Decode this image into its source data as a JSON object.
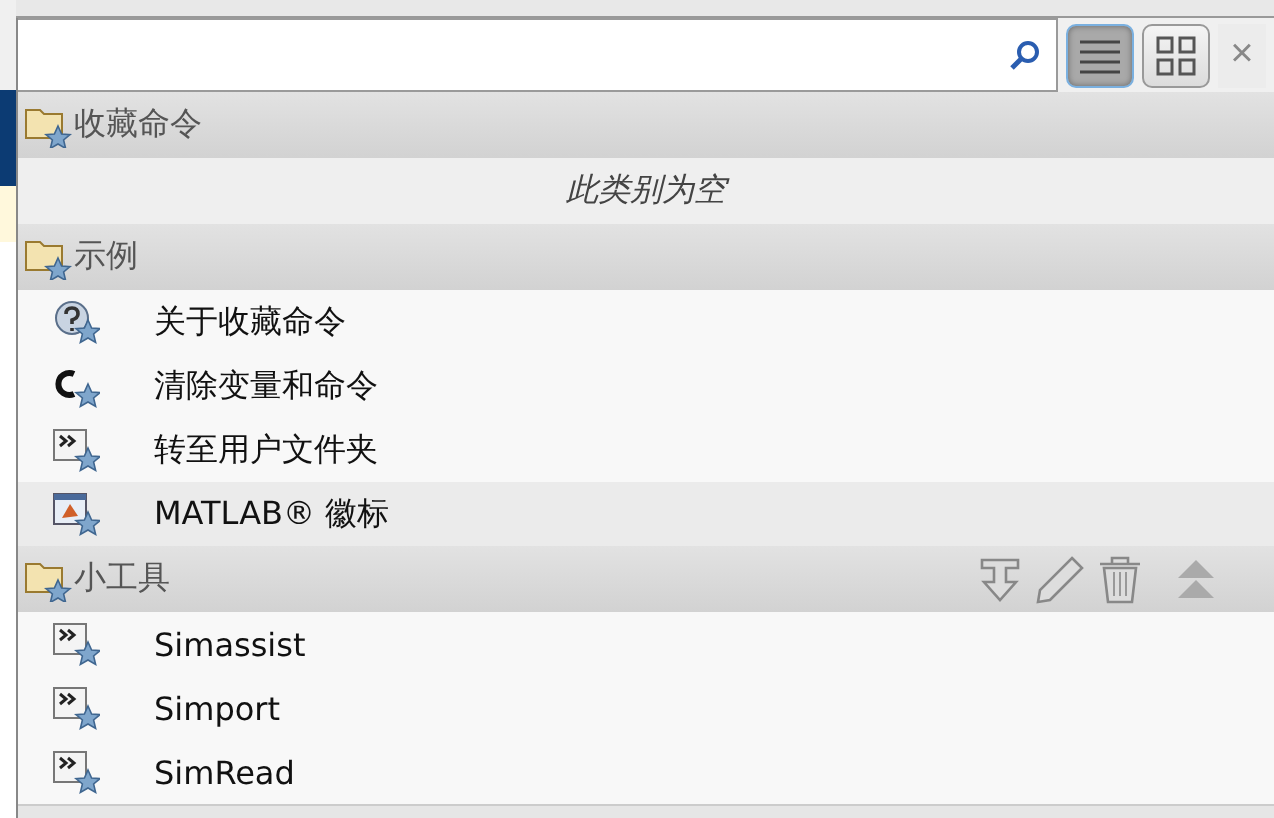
{
  "close_label": "×",
  "view_buttons": [
    {
      "kind": "list",
      "selected": true
    },
    {
      "kind": "grid",
      "selected": false
    }
  ],
  "categories": [
    {
      "title": "收藏命令",
      "show_actions": false,
      "empty_text": "此类别为空"
    },
    {
      "title": "示例",
      "show_actions": false,
      "items": [
        {
          "label": "关于收藏命令",
          "kind": "help",
          "highlighted": false
        },
        {
          "label": "清除变量和命令",
          "kind": "clear",
          "highlighted": false
        },
        {
          "label": "转至用户文件夹",
          "kind": "script",
          "highlighted": false
        },
        {
          "label": "MATLAB® 徽标",
          "kind": "logo",
          "highlighted": true
        }
      ]
    },
    {
      "title": "小工具",
      "show_actions": true,
      "items": [
        {
          "label": "Simassist",
          "kind": "script",
          "highlighted": false
        },
        {
          "label": "Simport",
          "kind": "script",
          "highlighted": false
        },
        {
          "label": "SimRead",
          "kind": "script",
          "highlighted": false
        }
      ]
    }
  ]
}
